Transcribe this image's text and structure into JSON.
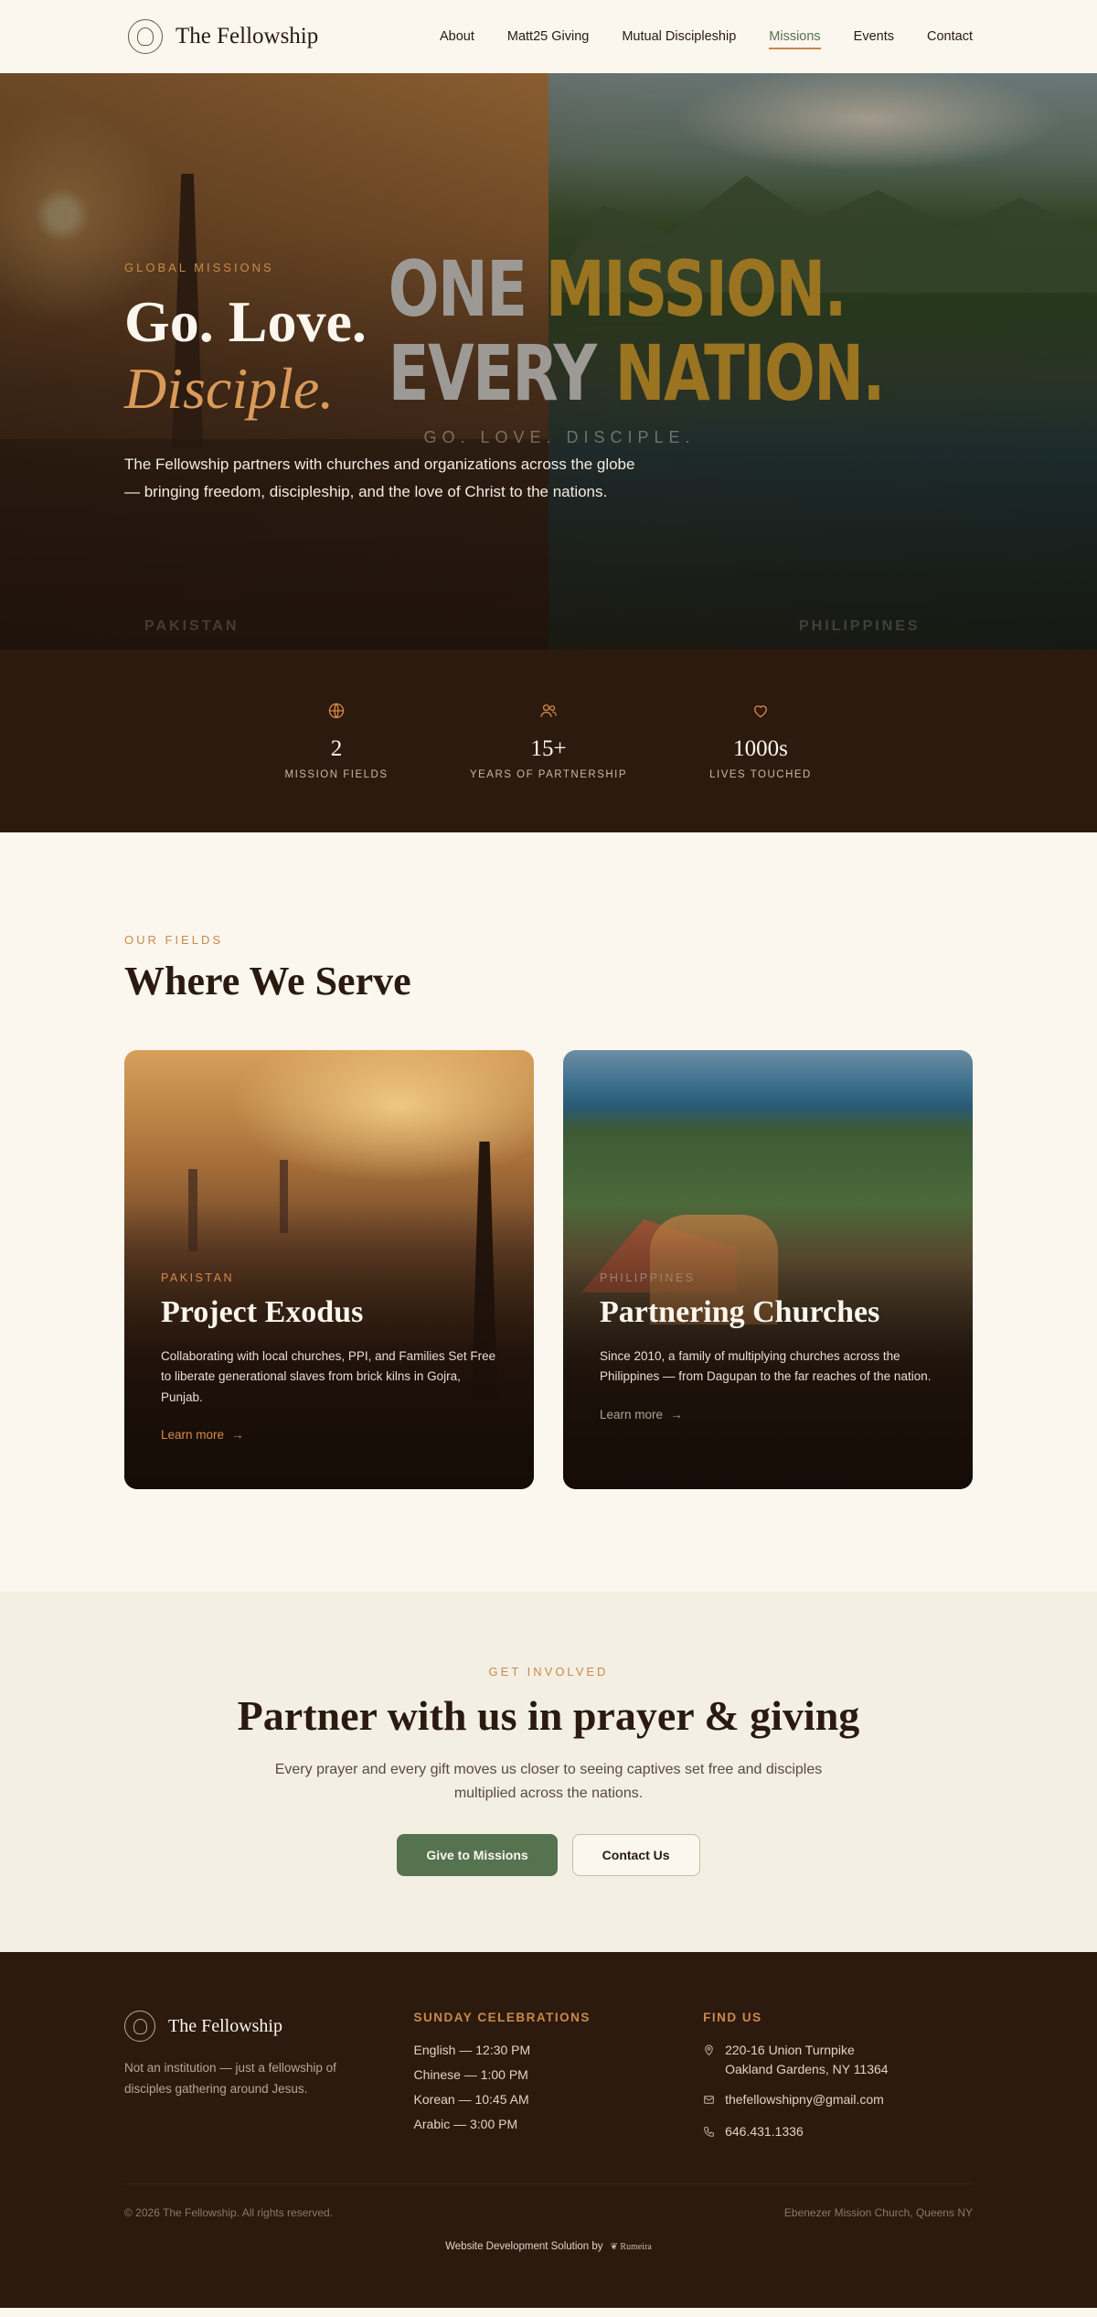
{
  "nav": {
    "brand": "The Fellowship",
    "links": [
      {
        "label": "About"
      },
      {
        "label": "Matt25 Giving"
      },
      {
        "label": "Mutual Discipleship"
      },
      {
        "label": "Missions"
      },
      {
        "label": "Events"
      },
      {
        "label": "Contact"
      }
    ],
    "active": "Missions"
  },
  "hero": {
    "eyebrow": "Global Missions",
    "title": "Go. Love.",
    "subtitle": "Disciple.",
    "text": "The Fellowship partners with churches and organizations across the globe — bringing freedom, discipleship, and the love of Christ to the nations.",
    "poster": {
      "line1_a": "ONE",
      "line1_b": "MISSION.",
      "line2_a": "EVERY",
      "line2_b": "NATION.",
      "tagline": "GO. LOVE. DISCIPLE."
    },
    "left_caption": "PAKISTAN",
    "right_caption": "PHILIPPINES"
  },
  "stats": [
    {
      "icon": "globe-icon",
      "value": "2",
      "label": "Mission Fields"
    },
    {
      "icon": "people-icon",
      "value": "15+",
      "label": "Years of Partnership"
    },
    {
      "icon": "heart-icon",
      "value": "1000s",
      "label": "Lives Touched"
    }
  ],
  "fields": {
    "eyebrow": "Our Fields",
    "title": "Where We Serve",
    "cards": [
      {
        "eyebrow": "Pakistan",
        "title": "Project Exodus",
        "text": "Collaborating with local churches, PPI, and Families Set Free to liberate generational slaves from brick kilns in Gojra, Punjab.",
        "link": "Learn more"
      },
      {
        "eyebrow": "Philippines",
        "title": "Partnering Churches",
        "text": "Since 2010, a family of multiplying churches across the Philippines — from Dagupan to the far reaches of the nation.",
        "link": "Learn more"
      }
    ]
  },
  "cta": {
    "eyebrow": "Get Involved",
    "title": "Partner with us in prayer & giving",
    "text": "Every prayer and every gift moves us closer to seeing captives set free and disciples multiplied across the nations.",
    "primary": "Give to Missions",
    "secondary": "Contact Us"
  },
  "footer": {
    "brand": "The Fellowship",
    "tagline": "Not an institution — just a fellowship of disciples gathering around Jesus.",
    "celebrations_heading": "Sunday Celebrations",
    "celebrations": [
      "English — 12:30 PM",
      "Chinese — 1:00 PM",
      "Korean — 10:45 AM",
      "Arabic — 3:00 PM"
    ],
    "find_heading": "Find Us",
    "address_line1": "220-16 Union Turnpike",
    "address_line2": "Oakland Gardens, NY 11364",
    "email": "thefellowshipny@gmail.com",
    "phone": "646.431.1336",
    "copyright": "© 2026 The Fellowship. All rights reserved.",
    "location_note": "Ebenezer Mission Church, Queens NY",
    "credit": "Website Development Solution by",
    "credit_brand": "Rumeira"
  },
  "colors": {
    "accent": "#c98a4a",
    "primary_green": "#55734f",
    "dark_brown": "#2c1a0f",
    "cream": "#fbf6ee"
  }
}
